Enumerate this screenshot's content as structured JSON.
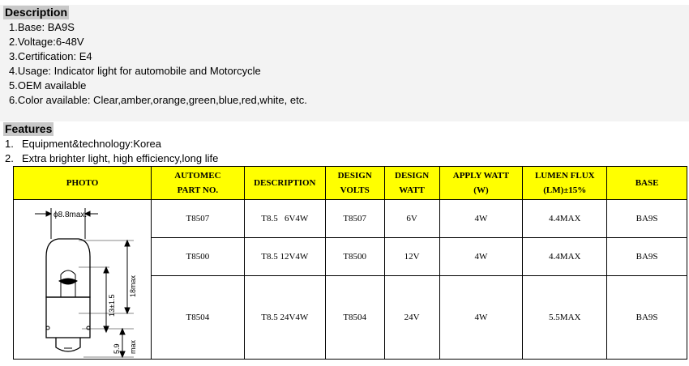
{
  "description": {
    "heading": "Description",
    "items": [
      "1.Base: BA9S",
      "2.Voltage:6-48V",
      "3.Certification: E4",
      "4.Usage: Indicator light for automobile and Motorcycle",
      "5.OEM available",
      "6.Color available: Clear,amber,orange,green,blue,red,white, etc."
    ]
  },
  "features": {
    "heading": "Features",
    "items": [
      {
        "num": "1.",
        "text": "Equipment&technology:Korea"
      },
      {
        "num": "2.",
        "text": "Extra brighter light, high efficiency,long life"
      }
    ]
  },
  "table": {
    "headers": {
      "photo": "PHOTO",
      "part_1": "AUTOMEC",
      "part_2": "PART NO.",
      "description": "DESCRIPTION",
      "volts_1": "DESIGN",
      "volts_2": "VOLTS",
      "watt_1": "DESIGN",
      "watt_2": "WATT",
      "apply_1": "APPLY WATT",
      "apply_2": "(W)",
      "lumen_1": "LUMEN FLUX",
      "lumen_2": "(LM)±15%",
      "base": "BASE"
    },
    "rows": [
      {
        "part": "T8507",
        "description": "T8.5   6V4W",
        "volts": "T8507",
        "watt": "6V",
        "apply": "4W",
        "lumen": "4.4MAX",
        "base": "BA9S"
      },
      {
        "part": "T8500",
        "description": "T8.5 12V4W",
        "volts": "T8500",
        "watt": "12V",
        "apply": "4W",
        "lumen": "4.4MAX",
        "base": "BA9S"
      },
      {
        "part": "T8504",
        "description": "T8.5 24V4W",
        "volts": "T8504",
        "watt": "24V",
        "apply": "4W",
        "lumen": "5.5MAX",
        "base": "BA9S"
      }
    ],
    "drawing": {
      "diameter": "ϕ8.8max.",
      "length_total": "18max",
      "length_glass": "13±1.5",
      "base_len": "5.9",
      "base_max": "max"
    }
  },
  "colors": {
    "header_bg": "#ffff00",
    "heading_bg": "#c8c8c8",
    "band_bg": "#f3f3f3"
  }
}
